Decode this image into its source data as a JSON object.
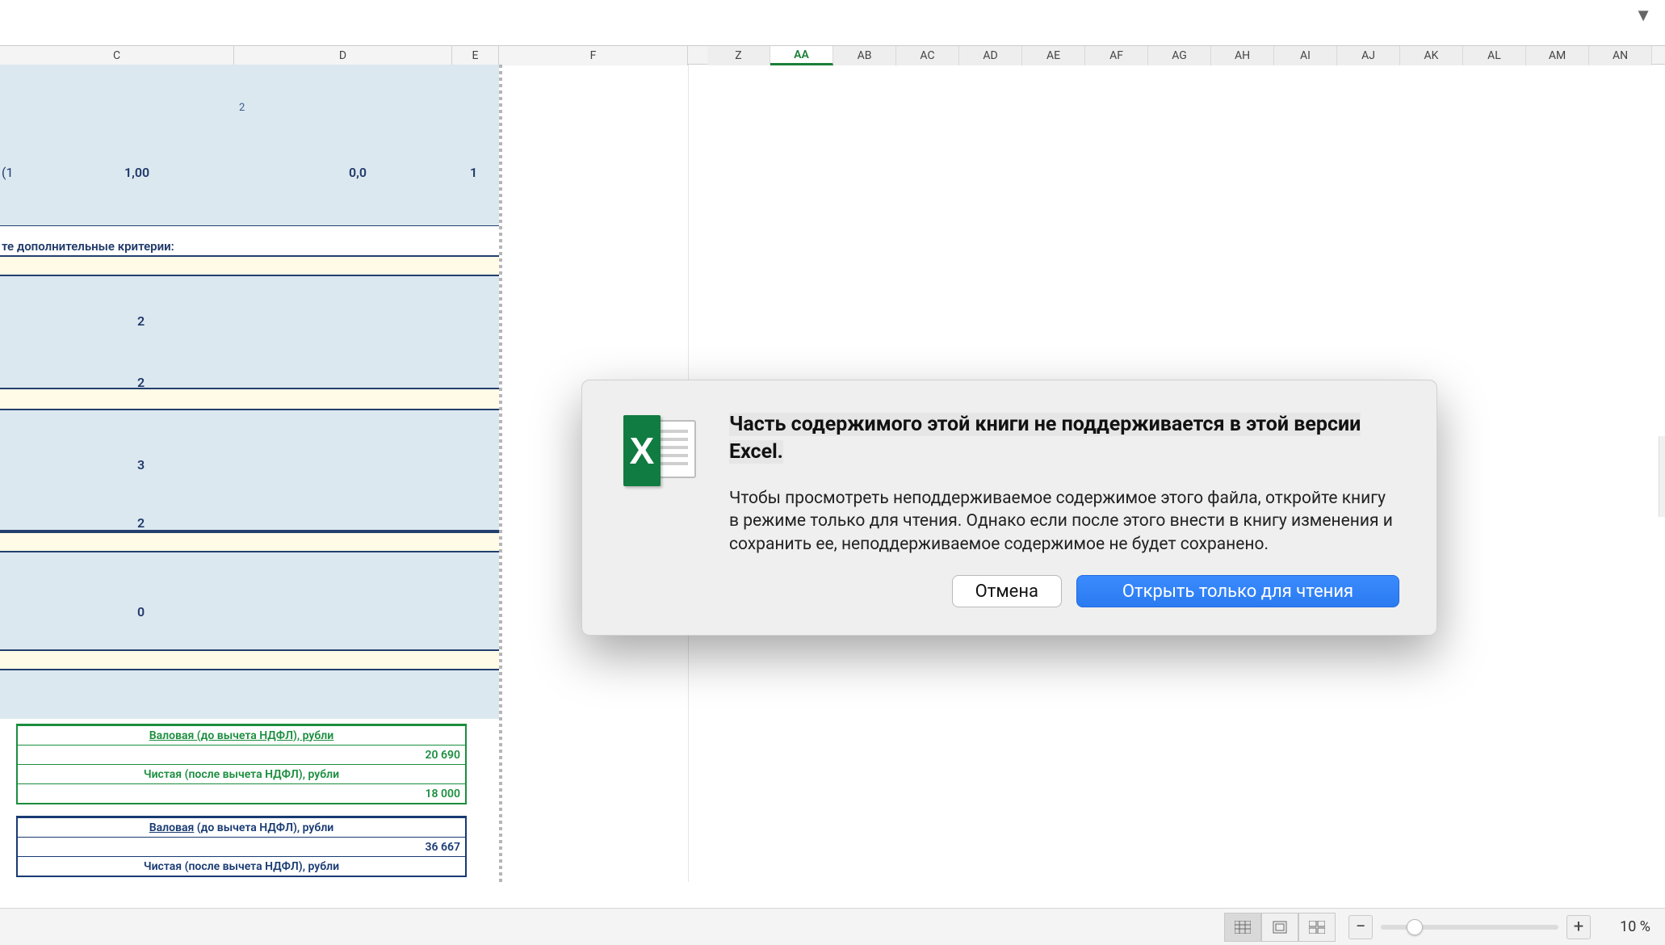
{
  "columns": {
    "visible": [
      "C",
      "D",
      "E",
      "F",
      "Z",
      "AA",
      "AB",
      "AC",
      "AD",
      "AE",
      "AF",
      "AG",
      "AH",
      "AI",
      "AJ",
      "AK",
      "AL",
      "AM",
      "AN"
    ],
    "selected": "AA",
    "widths": {
      "C": 290,
      "D": 270,
      "E": 58,
      "F": 234
    }
  },
  "sheet": {
    "header_small": "2",
    "row_vals": {
      "left_trail": "(1",
      "c": "1,00",
      "d": "0,0",
      "e": "1"
    },
    "criteria_label": "те дополнительные критерии:",
    "vals": [
      "2",
      "2",
      "3",
      "2",
      "0"
    ],
    "green_table": {
      "r1": "Валовая (до вычета НДФЛ), рубли",
      "r2": "20 690",
      "r3": "Чистая (после вычета НДФЛ), рубли",
      "r4": "18 000"
    },
    "blue_table": {
      "r1_a": "Валовая",
      "r1_b": " (до вычета НДФЛ), рубли",
      "r2": "36 667",
      "r3": "Чистая (после вычета НДФЛ), рубли"
    }
  },
  "dialog": {
    "title": "Часть содержимого этой книги не поддерживается в этой версии Excel.",
    "message": "Чтобы просмотреть неподдерживаемое содержимое этого файла, откройте книгу в режиме только для чтения. Однако если после этого внести в книгу изменения и сохранить ее, неподдерживаемое содержимое не будет сохранено.",
    "cancel": "Отмена",
    "primary": "Открыть только для чтения"
  },
  "status": {
    "zoom": "10 %",
    "minus": "−",
    "plus": "+"
  },
  "icons": {
    "excel_x": "X",
    "chev": "▼"
  }
}
